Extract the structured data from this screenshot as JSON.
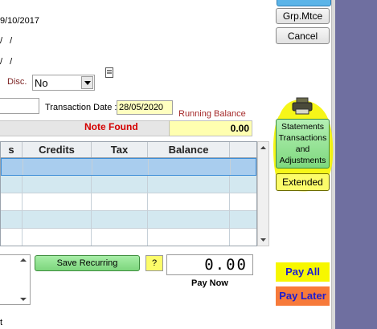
{
  "top_fields": {
    "date_fragment": "9/10/2017",
    "blank_date_1": "/ /",
    "blank_date_2": "/ /"
  },
  "buttons": {
    "grp_mtce": "Grp.Mtce",
    "cancel": "Cancel",
    "save_recurring": "Save Recurring",
    "help": "?",
    "pay_all": "Pay All",
    "pay_later": "Pay Later",
    "statements": "Statements Transactions and Adjustments",
    "extended": "Extended"
  },
  "disc": {
    "label": "Disc.",
    "value": "No"
  },
  "transaction": {
    "date_label": "Transaction Date :",
    "date_value": "28/05/2020"
  },
  "running_balance": {
    "label": "Running Balance",
    "value": "0.00"
  },
  "note_found": "Note Found",
  "grid": {
    "columns": [
      "s",
      "Credits",
      "Tax",
      "Balance"
    ]
  },
  "pay_now": {
    "amount": "0.00",
    "label": "Pay Now"
  },
  "bottom_fragment": "t",
  "colors": {
    "highlight_yellow": "#f5f500",
    "statements_green": "#8fe28f",
    "pay_later_orange": "#f77a3a",
    "row_selected": "#a9cdee",
    "row_alt": "#d3e8f0"
  }
}
